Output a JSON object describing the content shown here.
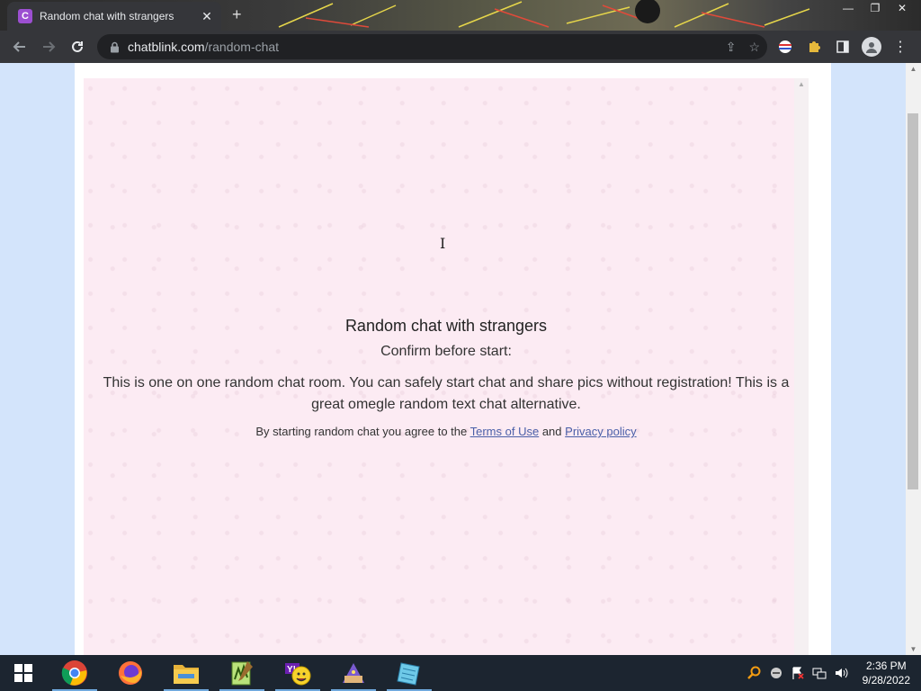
{
  "browser": {
    "tab_title": "Random chat with strangers",
    "tab_favicon_letter": "C",
    "url_domain": "chatblink.com",
    "url_path": "/random-chat"
  },
  "page": {
    "title": "Random chat with strangers",
    "subtitle": "Confirm before start:",
    "description": "This is one on one random chat room. You can safely start chat and share pics without registration! This is a great omegle random text chat alternative.",
    "terms_prefix": "By starting random chat you agree to the",
    "terms_link": "Terms of Use",
    "terms_and": "and",
    "privacy_link": "Privacy policy"
  },
  "taskbar": {
    "apps": [
      "chrome-icon",
      "firefox-icon",
      "file-explorer-icon",
      "notepad-plus-icon",
      "yahoo-messenger-icon",
      "wizard-app-icon",
      "notebook-app-icon"
    ],
    "time": "2:36 PM",
    "date": "9/28/2022"
  },
  "colors": {
    "panel_bg": "#fcebf3",
    "page_bg": "#d3e4fb",
    "link": "#4a5fa8",
    "favicon": "#9c4fd1"
  }
}
